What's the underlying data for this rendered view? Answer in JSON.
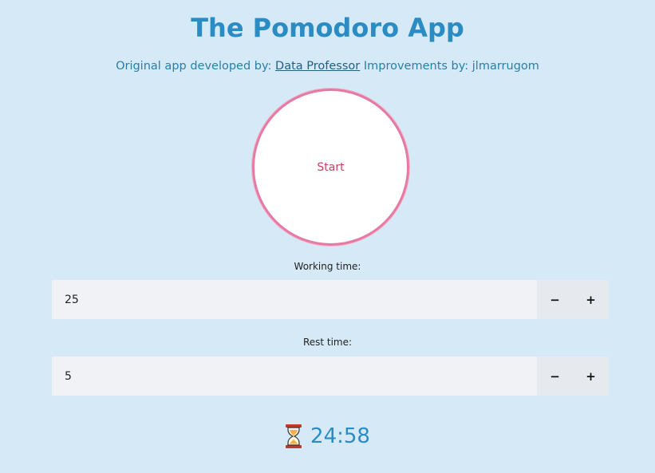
{
  "header": {
    "title": "The Pomodoro App",
    "credits_prefix": "Original app developed by: ",
    "credits_link": "Data Professor",
    "credits_suffix": " Improvements by: jlmarrugom"
  },
  "start_button": {
    "label": "Start"
  },
  "working_time": {
    "label": "Working time:",
    "value": "25",
    "decrement": "−",
    "increment": "+"
  },
  "rest_time": {
    "label": "Rest time:",
    "value": "5",
    "decrement": "−",
    "increment": "+"
  },
  "timer": {
    "icon": "hourglass-icon",
    "display": "24:58"
  },
  "colors": {
    "background": "#d6e9f6",
    "accent": "#2b8cc4",
    "start_border": "#e57aa3",
    "start_text": "#c8405f"
  }
}
